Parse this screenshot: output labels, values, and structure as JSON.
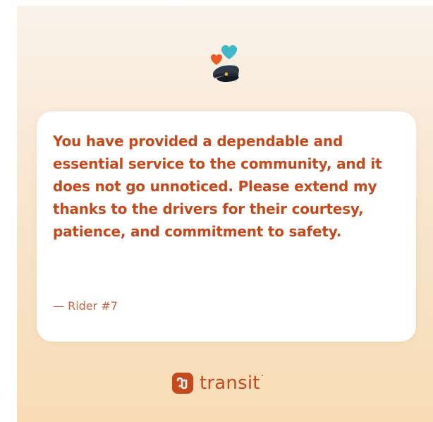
{
  "card": {
    "quote": "You have provided a dependable and essential service to the community, and it does not go unnoticed. Please extend my thanks to the drivers for their courtesy, patience, and commitment to safety.",
    "attribution": "— Rider #7"
  },
  "brand": {
    "name": "transit",
    "dot": "·",
    "logo_icon": "transit-logo-icon"
  },
  "icons": {
    "hero": "hearts-and-driver-cap-icon"
  },
  "colors": {
    "accent": "#c44a1c",
    "background_top": "#faf2ea",
    "background_bottom": "#f7dcb6",
    "card": "#ffffff",
    "heart_teal": "#3fb8c8",
    "heart_orange": "#ee5a24",
    "cap": "#2f3a48"
  }
}
